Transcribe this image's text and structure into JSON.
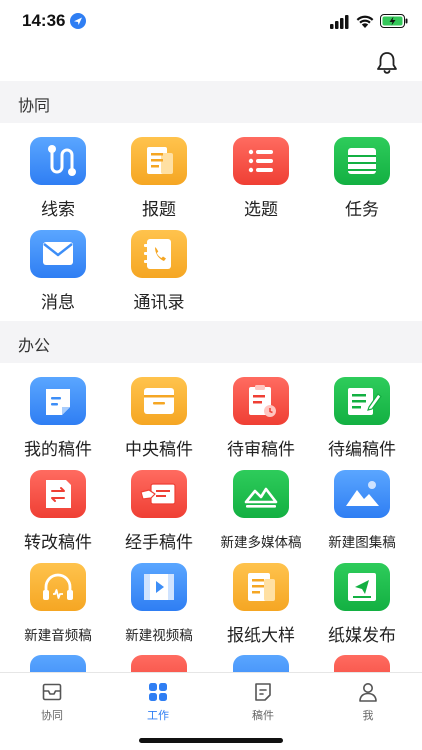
{
  "status_bar": {
    "time": "14:36"
  },
  "sections": {
    "collab": {
      "title": "协同"
    },
    "office": {
      "title": "办公"
    }
  },
  "collab_items": [
    {
      "label": "线索",
      "icon": "thread-icon",
      "color": "#3d8ef7"
    },
    {
      "label": "报题",
      "icon": "report-topic-icon",
      "color": "#f5a623"
    },
    {
      "label": "选题",
      "icon": "topic-list-icon",
      "color": "#ef3f34"
    },
    {
      "label": "任务",
      "icon": "task-icon",
      "color": "#13b042"
    },
    {
      "label": "消息",
      "icon": "mail-icon",
      "color": "#3d8ef7"
    },
    {
      "label": "通讯录",
      "icon": "contacts-icon",
      "color": "#f5a623"
    }
  ],
  "office_items": [
    {
      "label": "我的稿件",
      "icon": "my-draft-icon"
    },
    {
      "label": "中央稿件",
      "icon": "central-draft-icon"
    },
    {
      "label": "待审稿件",
      "icon": "pending-review-icon"
    },
    {
      "label": "待编稿件",
      "icon": "pending-edit-icon"
    },
    {
      "label": "转改稿件",
      "icon": "transfer-draft-icon"
    },
    {
      "label": "经手稿件",
      "icon": "handled-draft-icon"
    },
    {
      "label": "新建多媒体稿",
      "icon": "new-multimedia-icon"
    },
    {
      "label": "新建图集稿",
      "icon": "new-gallery-icon"
    },
    {
      "label": "新建音频稿",
      "icon": "new-audio-icon"
    },
    {
      "label": "新建视频稿",
      "icon": "new-video-icon"
    },
    {
      "label": "报纸大样",
      "icon": "newspaper-proof-icon"
    },
    {
      "label": "纸媒发布",
      "icon": "print-publish-icon"
    }
  ],
  "tab_bar": {
    "tabs": [
      {
        "label": "协同",
        "icon": "inbox-icon",
        "active": false
      },
      {
        "label": "工作",
        "icon": "grid-icon",
        "active": true
      },
      {
        "label": "稿件",
        "icon": "document-icon",
        "active": false
      },
      {
        "label": "我",
        "icon": "person-icon",
        "active": false
      }
    ]
  }
}
